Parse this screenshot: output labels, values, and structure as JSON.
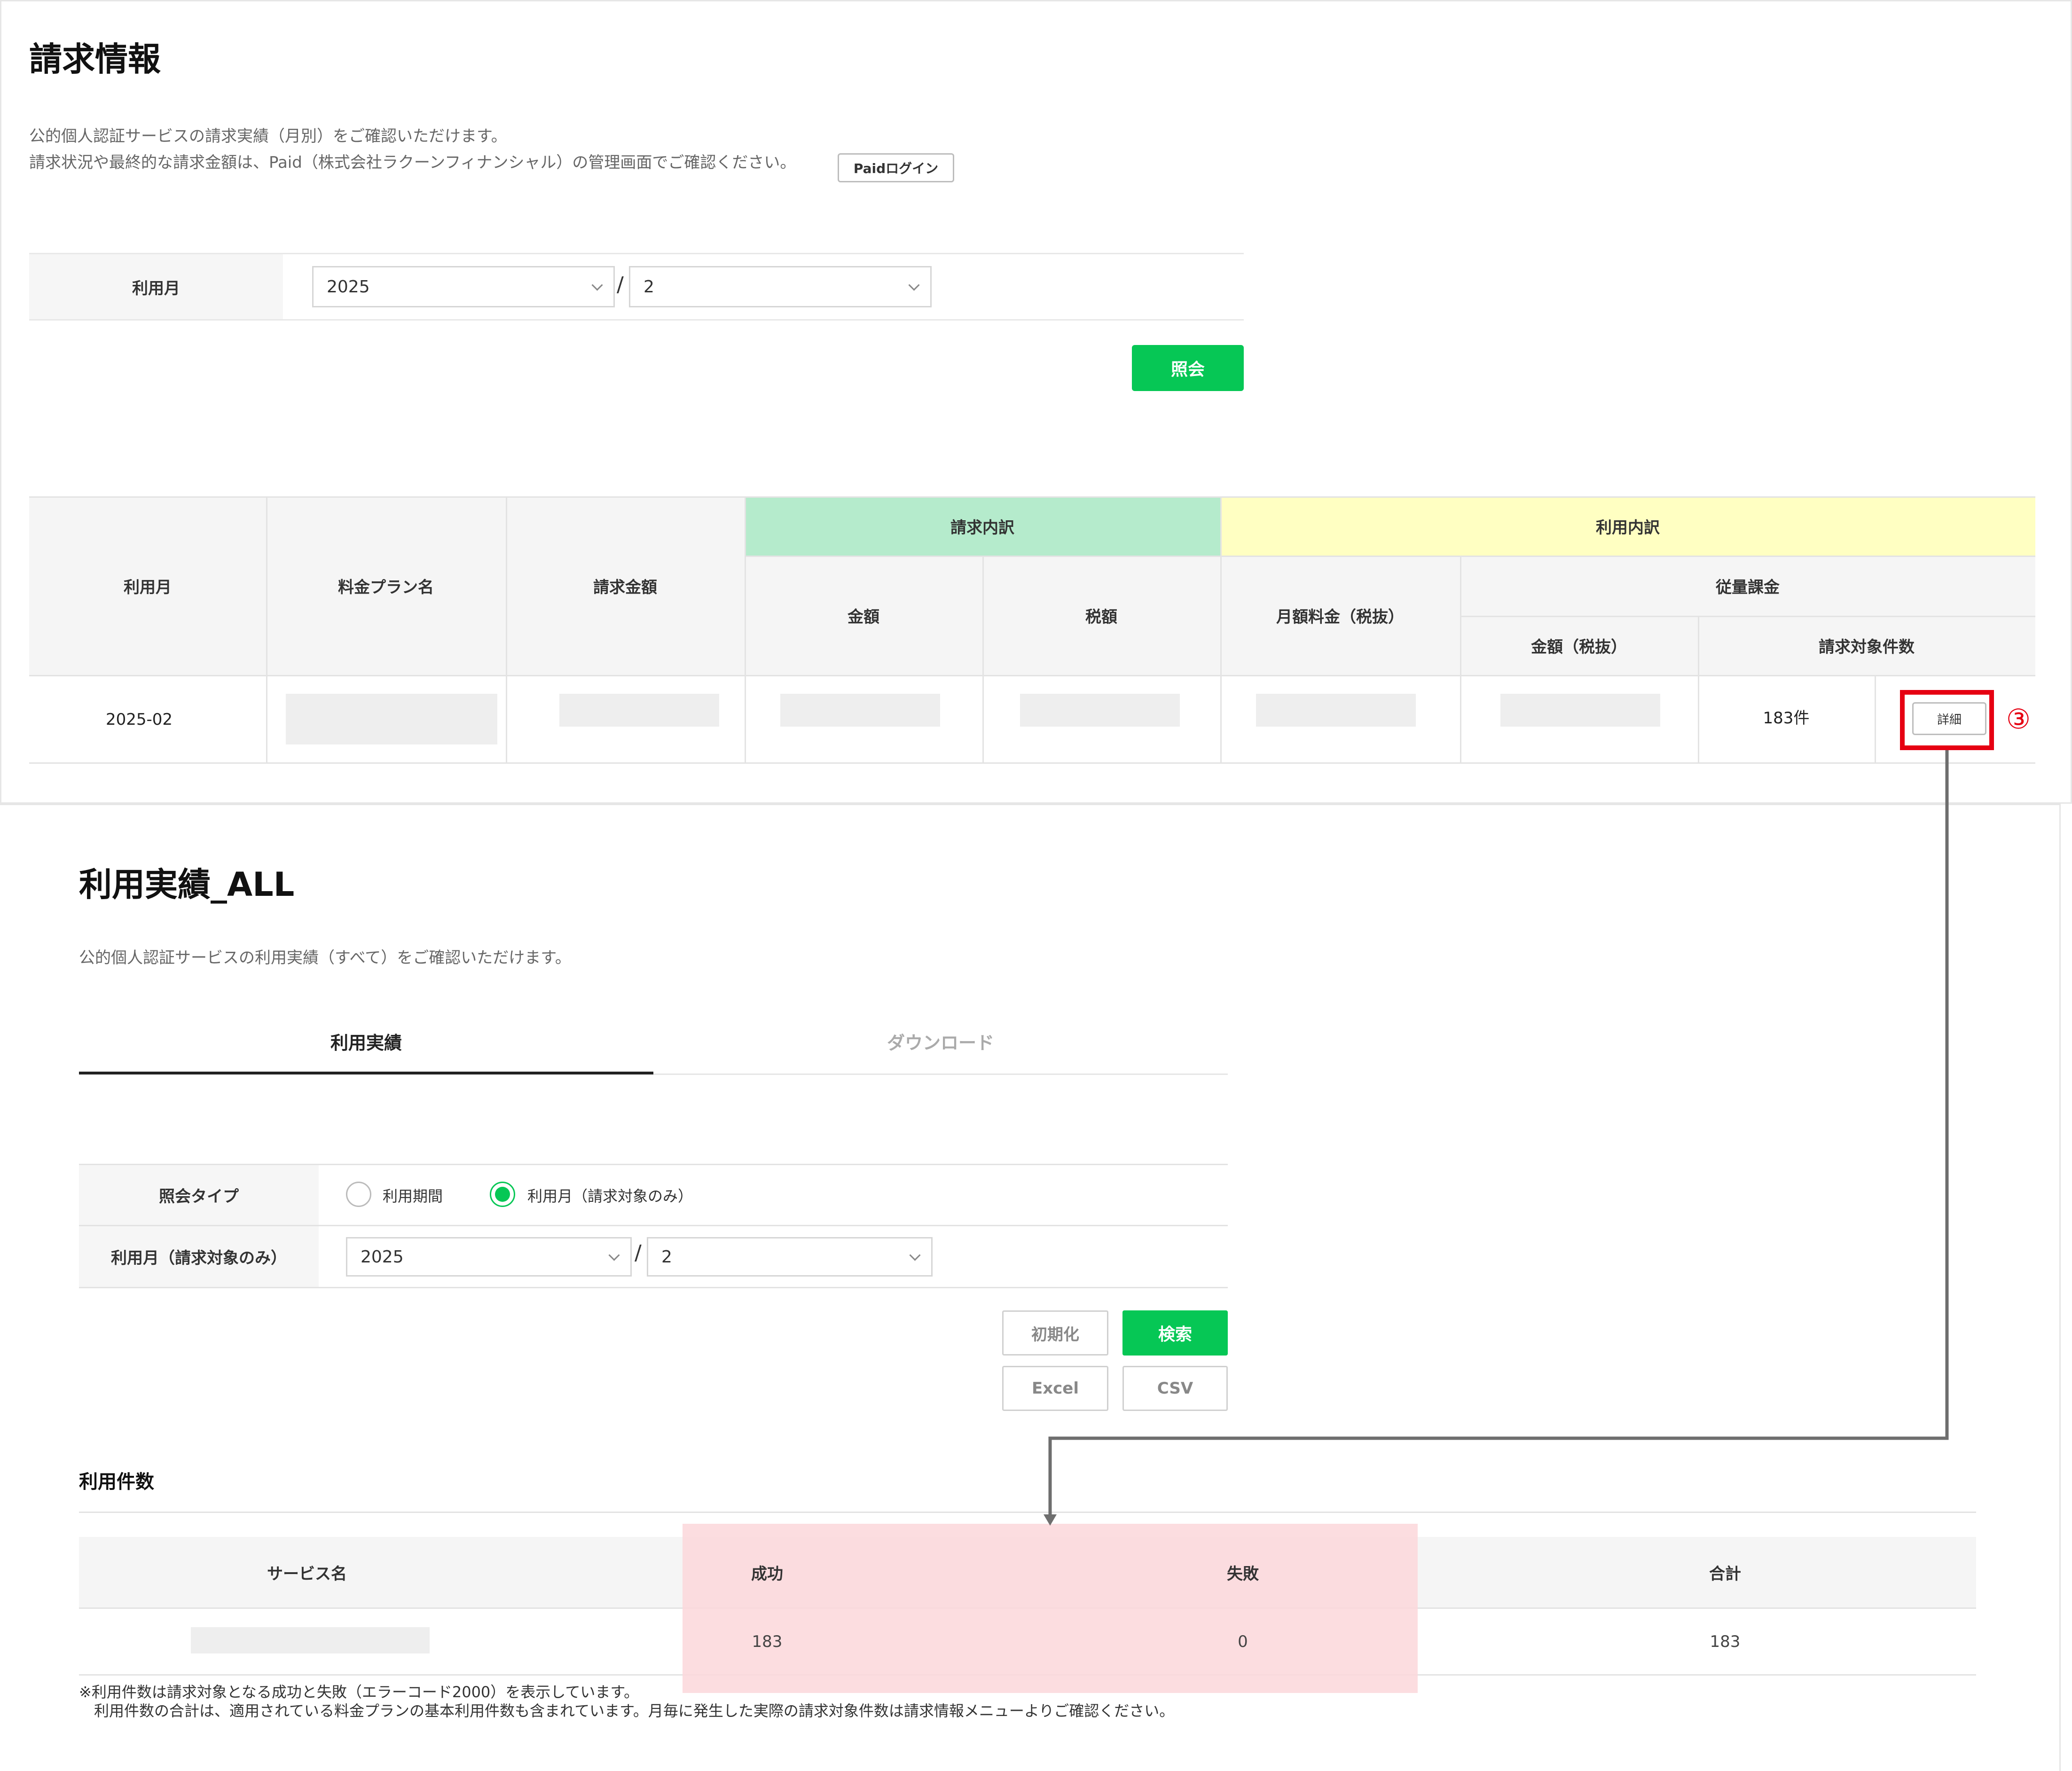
{
  "billing": {
    "title": "請求情報",
    "desc_line1": "公的個人認証サービスの請求実績（月別）をご確認いただけます。",
    "desc_line2": "請求状況や最終的な請求金額は、Paid（株式会社ラクーンフィナンシャル）の管理画面でご確認ください。",
    "paid_login_label": "Paidログイン",
    "month_label": "利用月",
    "year_value": "2025",
    "month_value": "2",
    "slash": "/",
    "inquiry_label": "照会",
    "table": {
      "h_month": "利用月",
      "h_plan": "料金プラン名",
      "h_amount": "請求金額",
      "h_billing_breakdown": "請求内訳",
      "h_usage_breakdown": "利用内訳",
      "h_price": "金額",
      "h_tax": "税額",
      "h_monthly_fee": "月額料金（税抜）",
      "h_metered": "従量課金",
      "h_metered_amount": "金額（税抜）",
      "h_billable_count": "請求対象件数",
      "row_month": "2025-02",
      "row_count": "183件",
      "detail_label": "詳細"
    },
    "step_marker": "③",
    "colors": {
      "billing_header": "#b5ebcc",
      "usage_header": "#ffffc2",
      "highlight_box": "#e60012"
    }
  },
  "usage": {
    "title": "利用実績_ALL",
    "desc": "公的個人認証サービスの利用実績（すべて）をご確認いただけます。",
    "tabs": [
      {
        "label": "利用実績"
      },
      {
        "label": "ダウンロード"
      }
    ],
    "query_type_label": "照会タイプ",
    "radio_period": "利用期間",
    "radio_month": "利用月（請求対象のみ）",
    "month_label": "利用月（請求対象のみ）",
    "year_value": "2025",
    "month_value": "2",
    "slash": "/",
    "reset_label": "初期化",
    "search_label": "検索",
    "excel_label": "Excel",
    "csv_label": "CSV",
    "count_section_title": "利用件数",
    "table": {
      "h_service": "サービス名",
      "h_success": "成功",
      "h_fail": "失敗",
      "h_total": "合計",
      "success": "183",
      "fail": "0",
      "total": "183"
    },
    "note_line1": "※利用件数は請求対象となる成功と失敗（エラーコード2000）を表示しています。",
    "note_line2": "利用件数の合計は、適用されている料金プランの基本利用件数も含まれています。月毎に発生した実際の請求対象件数は請求情報メニューよりご確認ください。",
    "colors": {
      "accent": "#06c755",
      "highlight": "#fbd7da"
    }
  }
}
